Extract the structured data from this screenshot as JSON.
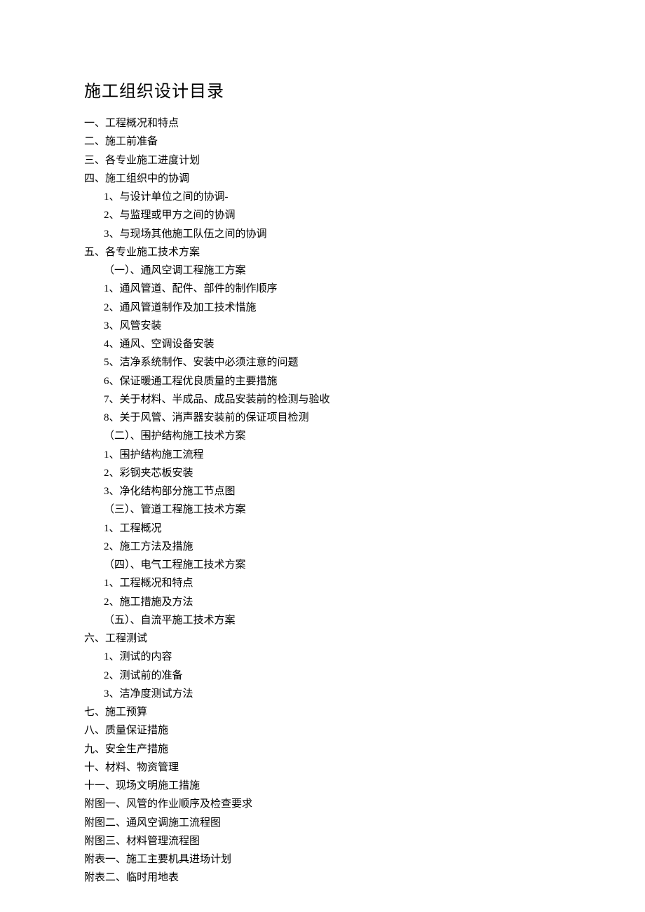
{
  "title": "施工组织设计目录",
  "toc": [
    {
      "level": 0,
      "text": "一、工程概况和特点"
    },
    {
      "level": 0,
      "text": "二、施工前准备"
    },
    {
      "level": 0,
      "text": "三、各专业施工进度计划"
    },
    {
      "level": 0,
      "text": "四、施工组织中的协调"
    },
    {
      "level": 1,
      "text": "1、与设计单位之间的协调-"
    },
    {
      "level": 1,
      "text": "2、与监理或甲方之间的协调"
    },
    {
      "level": 1,
      "text": "3、与现场其他施工队伍之间的协调"
    },
    {
      "level": 0,
      "text": "五、各专业施工技术方案"
    },
    {
      "level": 1,
      "text": "（一）、通风空调工程施工方案"
    },
    {
      "level": 1,
      "text": "1、通风管道、配件、部件的制作顺序"
    },
    {
      "level": 1,
      "text": "2、通风管道制作及加工技术惜施"
    },
    {
      "level": 1,
      "text": "3、风管安装"
    },
    {
      "level": 1,
      "text": "4、通风、空调设备安装"
    },
    {
      "level": 1,
      "text": "5、洁净系统制作、安装中必须注意的问题"
    },
    {
      "level": 1,
      "text": "6、保证暖通工程优良质量的主要措施"
    },
    {
      "level": 1,
      "text": "7、关于材料、半成品、成品安装前的检测与验收"
    },
    {
      "level": 1,
      "text": "8、关于风管、消声器安装前的保证项目检测"
    },
    {
      "level": 1,
      "text": "（二）、围护结构施工技术方案"
    },
    {
      "level": 1,
      "text": "1、围护结构施工流程"
    },
    {
      "level": 1,
      "text": "2、彩钢夹芯板安装"
    },
    {
      "level": 1,
      "text": "3、净化结构部分施工节点图"
    },
    {
      "level": 1,
      "text": "（三）、管道工程施工技术方案"
    },
    {
      "level": 1,
      "text": "1、工程概况"
    },
    {
      "level": 1,
      "text": "2、施工方法及措施"
    },
    {
      "level": 1,
      "text": "（四）、电气工程施工技术方案"
    },
    {
      "level": 1,
      "text": "1、工程概况和特点"
    },
    {
      "level": 1,
      "text": "2、施工措施及方法"
    },
    {
      "level": 1,
      "text": "（五）、自流平施工技术方案"
    },
    {
      "level": 0,
      "text": "六、工程测试"
    },
    {
      "level": 1,
      "text": "1、测试的内容"
    },
    {
      "level": 1,
      "text": "2、测试前的准备"
    },
    {
      "level": 1,
      "text": "3、洁净度测试方法"
    },
    {
      "level": 0,
      "text": "七、施工预算"
    },
    {
      "level": 0,
      "text": "八、质量保证措施"
    },
    {
      "level": 0,
      "text": "九、安全生产措施"
    },
    {
      "level": 0,
      "text": "十、材料、物资管理"
    },
    {
      "level": 0,
      "text": "十一、现场文明施工措施"
    },
    {
      "level": 0,
      "text": "附图一、风管的作业顺序及检查要求"
    },
    {
      "level": 0,
      "text": "附图二、通风空调施工流程图"
    },
    {
      "level": 0,
      "text": "附图三、材料管理流程图"
    },
    {
      "level": 0,
      "text": "附表一、施工主要机具进场计划"
    },
    {
      "level": 0,
      "text": "附表二、临时用地表"
    }
  ]
}
